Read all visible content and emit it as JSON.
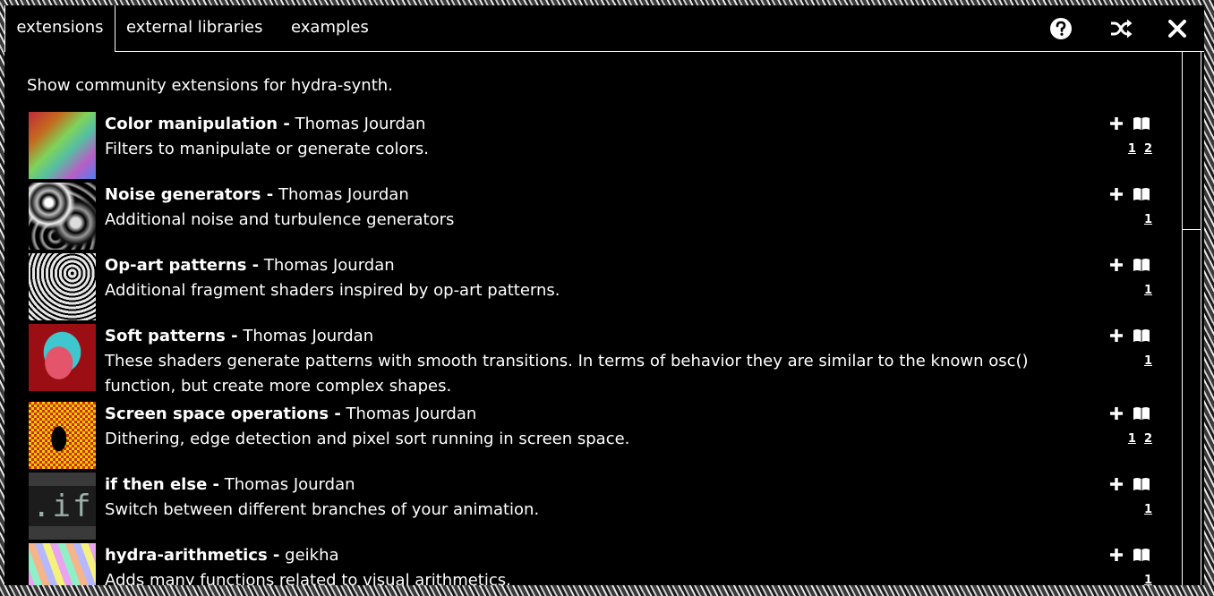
{
  "tabs": [
    {
      "label": "extensions"
    },
    {
      "label": "external libraries"
    },
    {
      "label": "examples"
    }
  ],
  "toolbar_icons": [
    "question-icon",
    "shuffle-icon",
    "close-icon"
  ],
  "intro": "Show community extensions for hydra-synth.",
  "items": [
    {
      "title": "Color manipulation -",
      "author": "Thomas Jourdan",
      "description": "Filters to manipulate or generate colors.",
      "links": [
        "1",
        "2"
      ],
      "thumb": "color-gradient"
    },
    {
      "title": "Noise generators -",
      "author": "Thomas Jourdan",
      "description": "Additional noise and turbulence generators",
      "links": [
        "1"
      ],
      "thumb": "noise"
    },
    {
      "title": "Op-art patterns -",
      "author": "Thomas Jourdan",
      "description": "Additional fragment shaders inspired by op-art patterns.",
      "links": [
        "1"
      ],
      "thumb": "op-art"
    },
    {
      "title": "Soft patterns -",
      "author": "Thomas Jourdan",
      "description": "These shaders generate patterns with smooth transitions. In terms of behavior they are similar to the known osc() function, but create more complex shapes.",
      "links": [
        "1"
      ],
      "thumb": "soft"
    },
    {
      "title": "Screen space operations -",
      "author": "Thomas Jourdan",
      "description": "Dithering, edge detection and pixel sort running in screen space.",
      "links": [
        "1",
        "2"
      ],
      "thumb": "dither"
    },
    {
      "title": "if then else -",
      "author": "Thomas Jourdan",
      "description": "Switch between different branches of your animation.",
      "links": [
        "1"
      ],
      "thumb": "if",
      "thumb_text": ".if"
    },
    {
      "title": "hydra-arithmetics -",
      "author": "geikha",
      "description": "Adds many functions related to visual arithmetics.",
      "links": [
        "1"
      ],
      "thumb": "arith"
    }
  ]
}
